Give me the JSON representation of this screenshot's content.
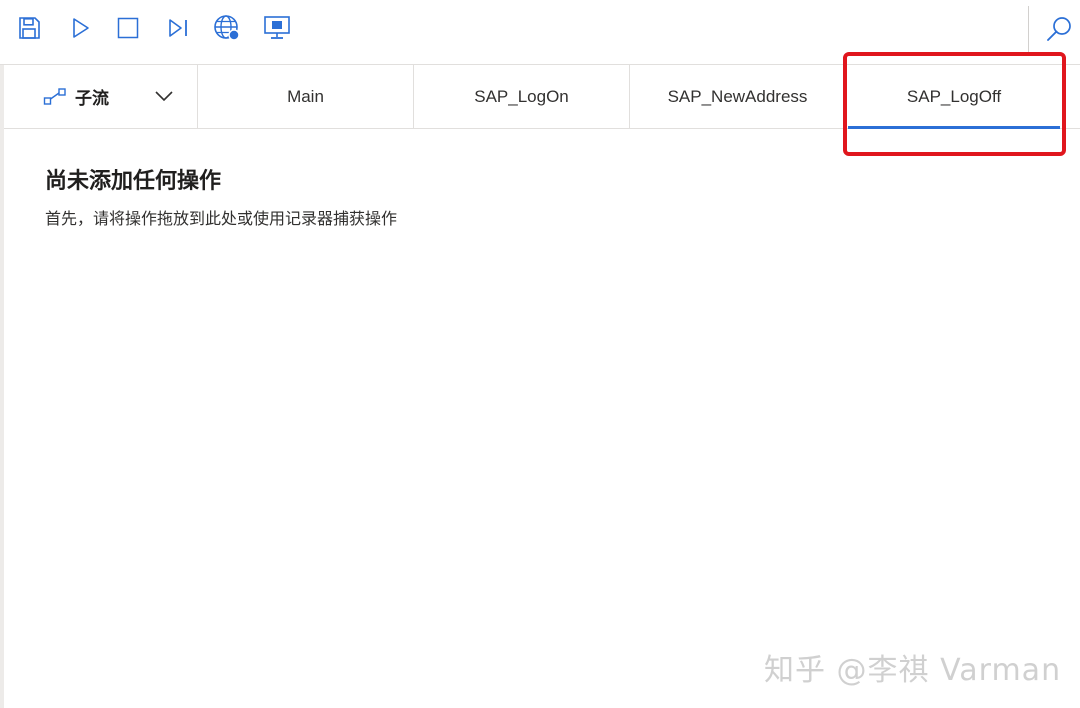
{
  "toolbar": {
    "buttons": [
      {
        "name": "save",
        "icon": "save-icon"
      },
      {
        "name": "run",
        "icon": "play-icon"
      },
      {
        "name": "stop",
        "icon": "stop-icon"
      },
      {
        "name": "step",
        "icon": "step-next-icon"
      },
      {
        "name": "web-recorder",
        "icon": "globe-icon"
      },
      {
        "name": "desktop-recorder",
        "icon": "monitor-icon"
      }
    ],
    "search_icon": "search-icon",
    "accent_color": "#2b6fd6"
  },
  "tabs": {
    "subflow_label": "子流",
    "items": [
      {
        "label": "Main",
        "active": false
      },
      {
        "label": "SAP_LogOn",
        "active": false
      },
      {
        "label": "SAP_NewAddress",
        "active": false
      },
      {
        "label": "SAP_LogOff",
        "active": true
      }
    ],
    "highlight_color": "#e0161d"
  },
  "empty_state": {
    "title": "尚未添加任何操作",
    "subtitle": "首先，请将操作拖放到此处或使用记录器捕获操作"
  },
  "watermark": "知乎 @李祺 Varman"
}
